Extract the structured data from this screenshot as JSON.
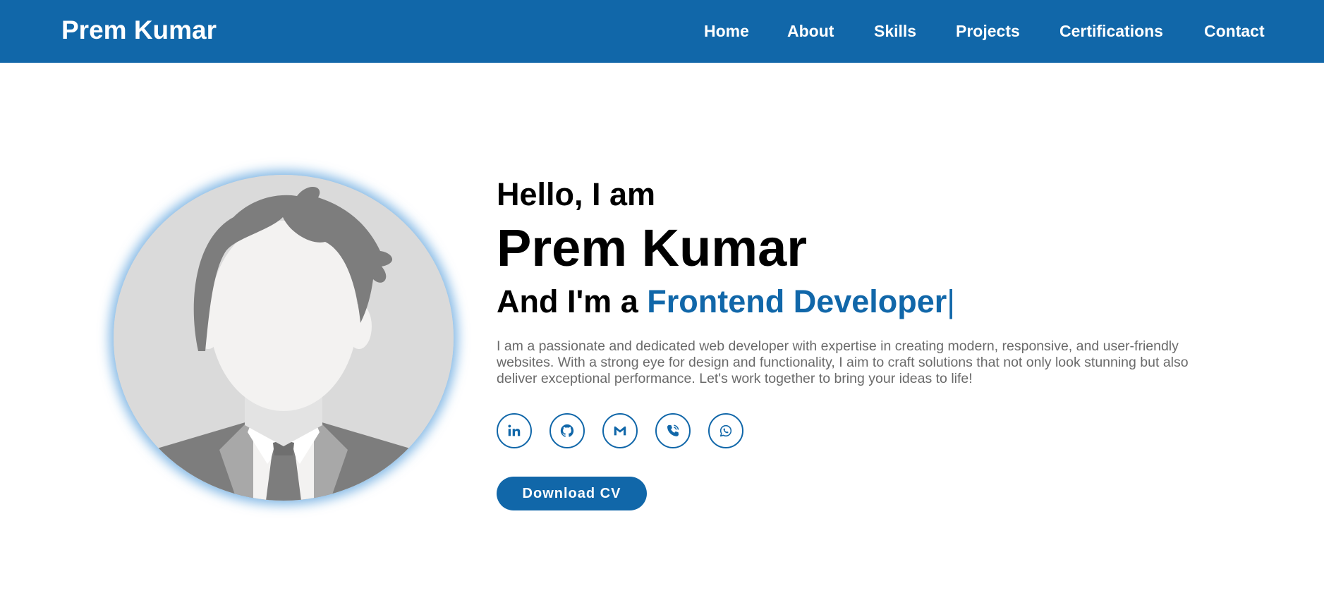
{
  "navbar": {
    "logo": "Prem Kumar",
    "links": [
      "Home",
      "About",
      "Skills",
      "Projects",
      "Certifications",
      "Contact"
    ]
  },
  "hero": {
    "greeting": "Hello, I am",
    "name": "Prem Kumar",
    "role_prefix": "And I'm a ",
    "role_highlight": "Frontend Developer",
    "cursor": "|",
    "bio": "I am a passionate and dedicated web developer with expertise in creating modern, responsive, and user-friendly websites. With a strong eye for design and functionality, I aim to craft solutions that not only look stunning but also deliver exceptional performance. Let's work together to bring your ideas to life!",
    "social_icons": [
      "linkedin-icon",
      "github-icon",
      "gmail-icon",
      "phone-icon",
      "whatsapp-icon"
    ],
    "download_label": "Download CV"
  },
  "colors": {
    "brand": "#1167a9",
    "text": "#000000",
    "muted": "#6a6a6a",
    "background": "#ffffff"
  }
}
